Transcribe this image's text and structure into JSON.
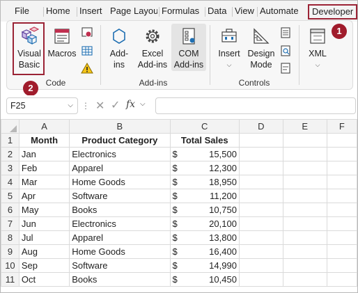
{
  "tabs": [
    "File",
    "Home",
    "Insert",
    "Page Layout",
    "Formulas",
    "Data",
    "View",
    "Automate",
    "Developer"
  ],
  "ribbon": {
    "code": {
      "visual_basic_line1": "Visual",
      "visual_basic_line2": "Basic",
      "macros_label": "Macros",
      "group_label": "Code"
    },
    "addins": {
      "addins_line1": "Add-",
      "addins_line2": "ins",
      "excel_addins_line1": "Excel",
      "excel_addins_line2": "Add-ins",
      "com_addins_line1": "COM",
      "com_addins_line2": "Add-ins",
      "group_label": "Add-ins"
    },
    "controls": {
      "insert_label": "Insert",
      "design_mode_line1": "Design",
      "design_mode_line2": "Mode",
      "group_label": "Controls"
    },
    "xml": {
      "xml_label": "XML"
    }
  },
  "badges": {
    "one": "1",
    "two": "2"
  },
  "formula_bar": {
    "name_box": "F25",
    "fx": "fx",
    "formula": ""
  },
  "columns": [
    "A",
    "B",
    "C",
    "D",
    "E",
    "F"
  ],
  "table": {
    "headers": [
      "Month",
      "Product Category",
      "Total Sales"
    ],
    "currency_symbol": "$",
    "rows": [
      {
        "row": "2",
        "month": "Jan",
        "category": "Electronics",
        "sales": "15,500"
      },
      {
        "row": "3",
        "month": "Feb",
        "category": "Apparel",
        "sales": "12,300"
      },
      {
        "row": "4",
        "month": "Mar",
        "category": "Home Goods",
        "sales": "18,950"
      },
      {
        "row": "5",
        "month": "Apr",
        "category": "Software",
        "sales": "11,200"
      },
      {
        "row": "6",
        "month": "May",
        "category": "Books",
        "sales": "10,750"
      },
      {
        "row": "7",
        "month": "Jun",
        "category": "Electronics",
        "sales": "20,100"
      },
      {
        "row": "8",
        "month": "Jul",
        "category": "Apparel",
        "sales": "13,800"
      },
      {
        "row": "9",
        "month": "Aug",
        "category": "Home Goods",
        "sales": "16,400"
      },
      {
        "row": "10",
        "month": "Sep",
        "category": "Software",
        "sales": "14,990"
      },
      {
        "row": "11",
        "month": "Oct",
        "category": "Books",
        "sales": "10,450"
      }
    ]
  },
  "header_row_number": "1",
  "colors": {
    "highlight": "#9b2335",
    "badge": "#a01c2c",
    "ribbon_bg": "#f7f7f7"
  }
}
